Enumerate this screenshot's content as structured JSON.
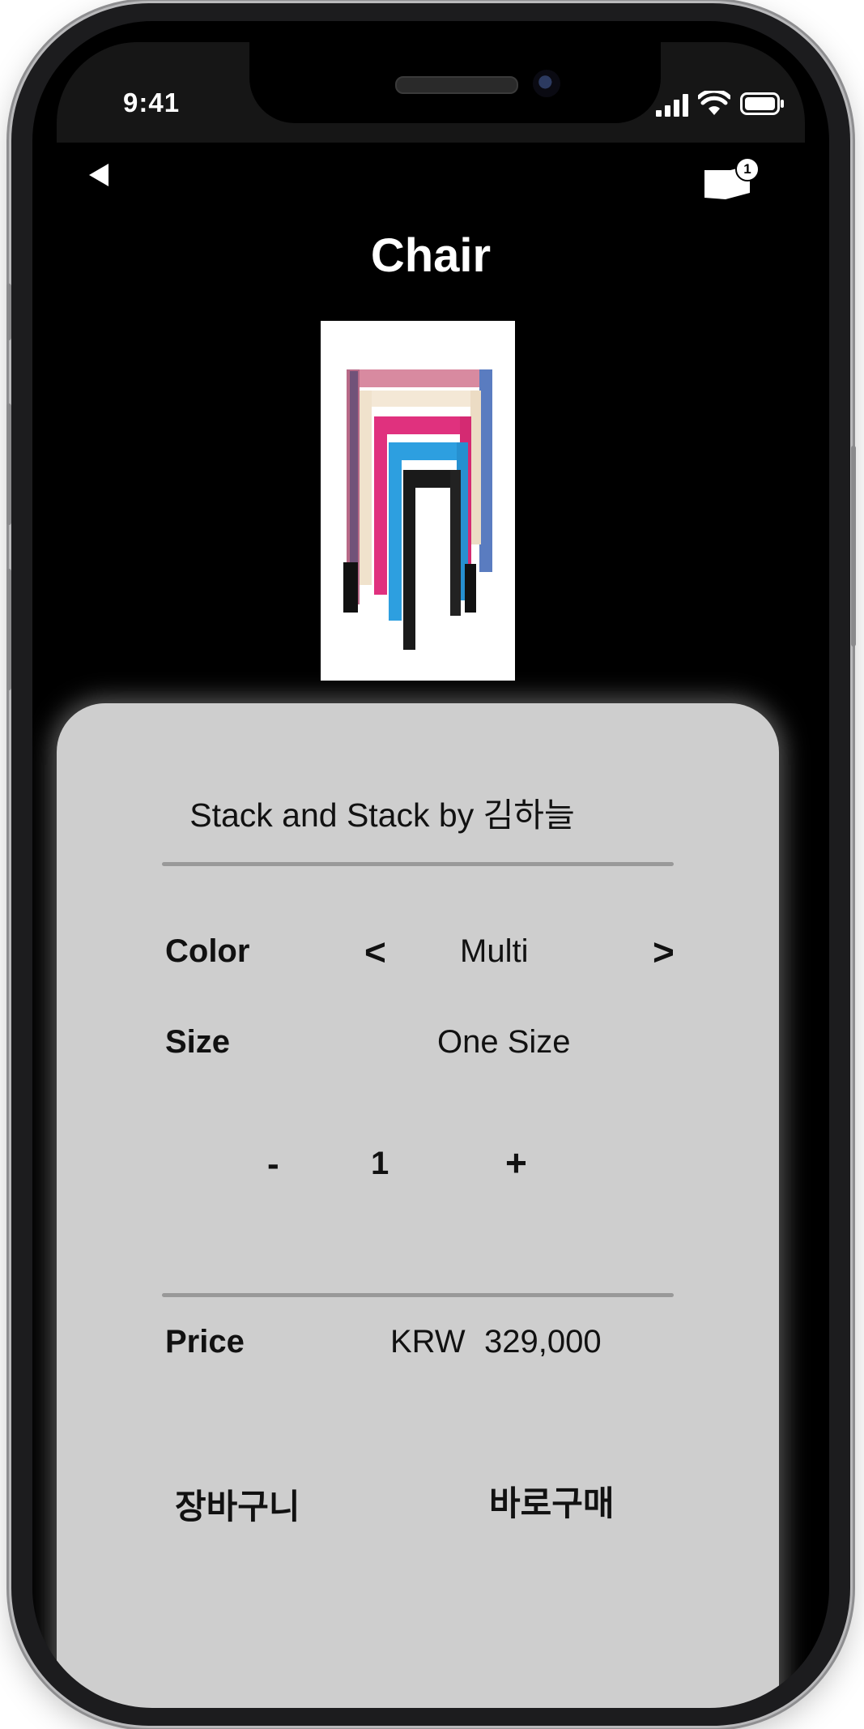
{
  "status_bar": {
    "time": "9:41"
  },
  "header": {
    "title": "Chair",
    "cart_count": "1"
  },
  "product": {
    "name": "Stack and Stack by 김하늘",
    "color_label": "Color",
    "color_value": "Multi",
    "prev_symbol": "<",
    "next_symbol": ">",
    "size_label": "Size",
    "size_value": "One Size",
    "qty_minus": "-",
    "qty_value": "1",
    "qty_plus": "+",
    "price_label": "Price",
    "currency": "KRW",
    "price": "329,000"
  },
  "actions": {
    "cart_button": "장바구니",
    "buy_button": "바로구매"
  },
  "colors": {
    "screen_bg": "#000000",
    "sheet_bg": "#cecece",
    "divider": "#999999",
    "stool_colors": [
      "#d8a7b0",
      "#f4e8d6",
      "#e0317e",
      "#2d9fe0",
      "#1a1a1a"
    ]
  }
}
